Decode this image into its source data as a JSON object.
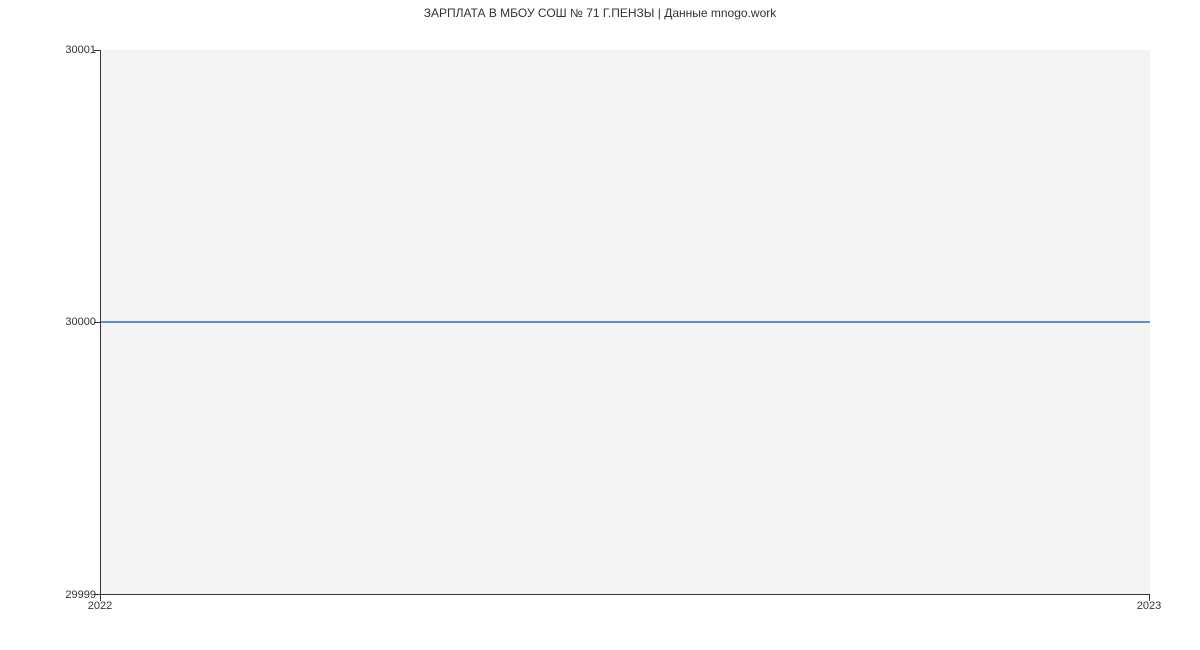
{
  "chart_data": {
    "type": "line",
    "title": "ЗАРПЛАТА В МБОУ СОШ № 71 Г.ПЕНЗЫ | Данные mnogo.work",
    "xlabel": "",
    "ylabel": "",
    "x": [
      "2022",
      "2023"
    ],
    "y": [
      30000,
      30000
    ],
    "ylim": [
      29999,
      30001
    ],
    "y_ticks": [
      29999,
      30000,
      30001
    ],
    "x_ticks": [
      "2022",
      "2023"
    ],
    "line_color": "#5b8fd6"
  }
}
